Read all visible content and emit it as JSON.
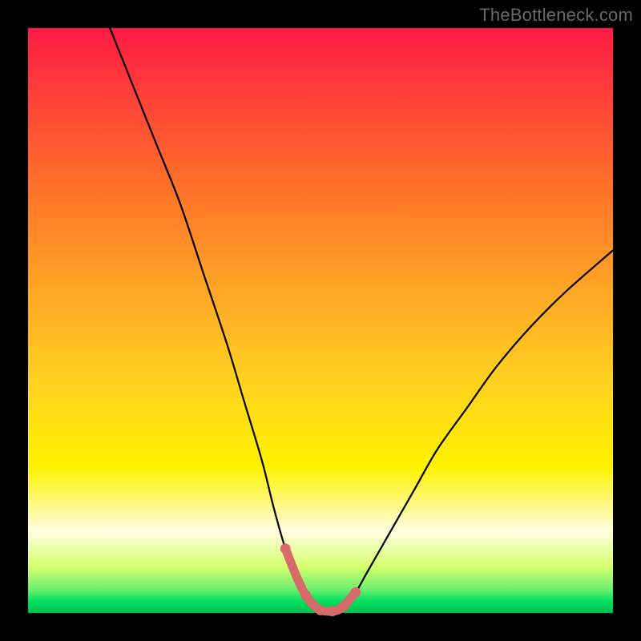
{
  "watermark": "TheBottleneck.com",
  "chart_data": {
    "type": "line",
    "title": "",
    "xlabel": "",
    "ylabel": "",
    "xlim": [
      0,
      100
    ],
    "ylim": [
      0,
      100
    ],
    "series": [
      {
        "name": "bottleneck-curve",
        "x": [
          14,
          18,
          22,
          26,
          30,
          34,
          37,
          40,
          42,
          44,
          46,
          47.5,
          49,
          50,
          51,
          52,
          53,
          54,
          56,
          58,
          62,
          66,
          70,
          75,
          80,
          86,
          92,
          100
        ],
        "values": [
          100,
          90,
          80,
          70,
          58,
          46,
          36,
          26,
          18,
          11,
          6,
          3,
          1.2,
          0.5,
          0.3,
          0.3,
          0.5,
          1.2,
          3.5,
          7,
          14,
          21,
          28,
          35,
          42,
          49,
          55,
          62
        ]
      }
    ],
    "highlight": {
      "name": "optimal-range",
      "x": [
        44,
        46,
        47.5,
        49,
        50,
        51,
        52,
        53,
        54,
        56
      ],
      "values": [
        11,
        6,
        3,
        1.2,
        0.5,
        0.3,
        0.3,
        0.5,
        1.2,
        3.5
      ]
    },
    "gradient_stops": [
      {
        "pos": 0,
        "color": "#ff1a44"
      },
      {
        "pos": 25,
        "color": "#ff6a2a"
      },
      {
        "pos": 60,
        "color": "#ffd020"
      },
      {
        "pos": 86,
        "color": "#fffde0"
      },
      {
        "pos": 100,
        "color": "#00c050"
      }
    ]
  }
}
